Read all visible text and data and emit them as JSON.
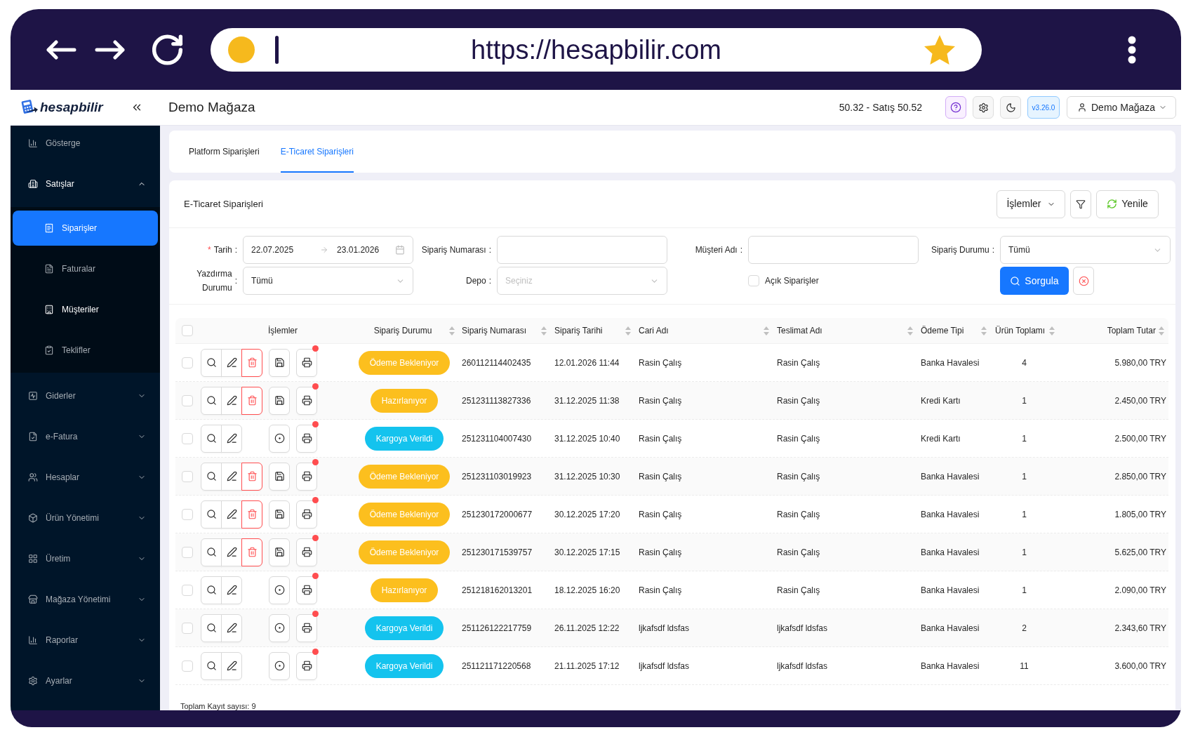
{
  "browser": {
    "url": "https://hesapbilir.com"
  },
  "header": {
    "logo": "hesapbilir",
    "title": "Demo Mağaza",
    "rate": "50.32 - Satış 50.52",
    "version": "v3.26.0",
    "user": "Demo Mağaza"
  },
  "sidebar": {
    "items": [
      {
        "label": "Gösterge",
        "selected": false
      },
      {
        "label": "Satışlar",
        "selected": false,
        "expanded": true,
        "children": [
          {
            "label": "Siparişler",
            "selected": true,
            "hovered": false
          },
          {
            "label": "Faturalar",
            "selected": false,
            "hovered": false
          },
          {
            "label": "Müşteriler",
            "selected": false,
            "hovered": true
          },
          {
            "label": "Teklifler",
            "selected": false,
            "hovered": false
          }
        ]
      },
      {
        "label": "Giderler",
        "selected": false,
        "expanded": false
      },
      {
        "label": "e-Fatura",
        "selected": false,
        "expanded": false
      },
      {
        "label": "Hesaplar",
        "selected": false,
        "expanded": false
      },
      {
        "label": "Ürün Yönetimi",
        "selected": false,
        "expanded": false
      },
      {
        "label": "Üretim",
        "selected": false,
        "expanded": false
      },
      {
        "label": "Mağaza Yönetimi",
        "selected": false,
        "expanded": false
      },
      {
        "label": "Raporlar",
        "selected": false,
        "expanded": false
      },
      {
        "label": "Ayarlar",
        "selected": false,
        "expanded": false
      }
    ]
  },
  "tabs": [
    {
      "label": "Platform Siparişleri",
      "selected": false
    },
    {
      "label": "E-Ticaret Siparişleri",
      "selected": true
    }
  ],
  "panel": {
    "title": "E-Ticaret Siparişleri",
    "menu_button": "İşlemler",
    "refresh_button": "Yenile",
    "query_button": "Sorgula",
    "filters": [
      {
        "kind": "date_range",
        "required_mark": "*",
        "label": "Tarih",
        "colon": ":",
        "start": "22.07.2025",
        "end": "23.01.2026"
      },
      {
        "kind": "text",
        "label": "Sipariş Numarası",
        "colon": ":"
      },
      {
        "kind": "text",
        "label": "Müşteri Adı",
        "colon": ":"
      },
      {
        "kind": "select",
        "label": "Sipariş Durumu",
        "colon": ":",
        "value": "Tümü"
      },
      {
        "kind": "select",
        "label": "Yazdırma Durumu",
        "colon": ":",
        "value": "Tümü"
      },
      {
        "kind": "select",
        "label": "Depo",
        "colon": ":",
        "placeholder": "Seçiniz"
      },
      {
        "kind": "checkbox",
        "label": "Açık Siparişler",
        "checked": false
      }
    ]
  },
  "table": {
    "select_all": false,
    "columns": [
      {
        "label": "İşlemler",
        "sortable": false
      },
      {
        "label": "Sipariş Durumu",
        "sortable": true
      },
      {
        "label": "Sipariş Numarası",
        "sortable": true
      },
      {
        "label": "Sipariş Tarihi",
        "sortable": true
      },
      {
        "label": "Cari Adı",
        "sortable": true
      },
      {
        "label": "Teslimat Adı",
        "sortable": true
      },
      {
        "label": "Ödeme Tipi",
        "sortable": true
      },
      {
        "label": "Ürün Toplamı",
        "sortable": true
      },
      {
        "label": "Toplam Tutar",
        "sortable": true
      }
    ],
    "rows": [
      {
        "selected": false,
        "deletable": true,
        "print_pending": true,
        "status": {
          "label": "Ödeme Bekleniyor",
          "color": "#fcbf1e"
        },
        "number": "260112114402435",
        "date": "12.01.2026 11:44",
        "customer": "Rasin Çalış",
        "recipient": "Rasin Çalış",
        "payment": "Banka Havalesi",
        "quantity": "4",
        "total": "5.980,00 TRY"
      },
      {
        "selected": false,
        "deletable": true,
        "print_pending": true,
        "status": {
          "label": "Hazırlanıyor",
          "color": "#fcbf1e"
        },
        "number": "251231113827336",
        "date": "31.12.2025 11:38",
        "customer": "Rasin Çalış",
        "recipient": "Rasin Çalış",
        "payment": "Kredi Kartı",
        "quantity": "1",
        "total": "2.450,00 TRY"
      },
      {
        "selected": false,
        "deletable": false,
        "print_pending": true,
        "status": {
          "label": "Kargoya Verildi",
          "color": "#14c3ee"
        },
        "number": "251231104007430",
        "date": "31.12.2025 10:40",
        "customer": "Rasin Çalış",
        "recipient": "Rasin Çalış",
        "payment": "Kredi Kartı",
        "quantity": "1",
        "total": "2.500,00 TRY"
      },
      {
        "selected": false,
        "deletable": true,
        "print_pending": true,
        "status": {
          "label": "Ödeme Bekleniyor",
          "color": "#fcbf1e"
        },
        "number": "251231103019923",
        "date": "31.12.2025 10:30",
        "customer": "Rasin Çalış",
        "recipient": "Rasin Çalış",
        "payment": "Banka Havalesi",
        "quantity": "1",
        "total": "2.850,00 TRY"
      },
      {
        "selected": false,
        "deletable": true,
        "print_pending": true,
        "status": {
          "label": "Ödeme Bekleniyor",
          "color": "#fcbf1e"
        },
        "number": "251230172000677",
        "date": "30.12.2025 17:20",
        "customer": "Rasin Çalış",
        "recipient": "Rasin Çalış",
        "payment": "Banka Havalesi",
        "quantity": "1",
        "total": "1.805,00 TRY"
      },
      {
        "selected": false,
        "deletable": true,
        "print_pending": true,
        "status": {
          "label": "Ödeme Bekleniyor",
          "color": "#fcbf1e"
        },
        "number": "251230171539757",
        "date": "30.12.2025 17:15",
        "customer": "Rasin Çalış",
        "recipient": "Rasin Çalış",
        "payment": "Banka Havalesi",
        "quantity": "1",
        "total": "5.625,00 TRY"
      },
      {
        "selected": false,
        "deletable": false,
        "print_pending": true,
        "status": {
          "label": "Hazırlanıyor",
          "color": "#fcbf1e"
        },
        "number": "251218162013201",
        "date": "18.12.2025 16:20",
        "customer": "Rasin Çalış",
        "recipient": "Rasin Çalış",
        "payment": "Banka Havalesi",
        "quantity": "1",
        "total": "2.090,00 TRY"
      },
      {
        "selected": false,
        "deletable": false,
        "print_pending": true,
        "status": {
          "label": "Kargoya Verildi",
          "color": "#14c3ee"
        },
        "number": "251126122217759",
        "date": "26.11.2025 12:22",
        "customer": "ljkafsdf ldsfas",
        "recipient": "ljkafsdf ldsfas",
        "payment": "Banka Havalesi",
        "quantity": "2",
        "total": "2.343,60 TRY"
      },
      {
        "selected": false,
        "deletable": false,
        "print_pending": true,
        "status": {
          "label": "Kargoya Verildi",
          "color": "#14c3ee"
        },
        "number": "251121171220568",
        "date": "21.11.2025 17:12",
        "customer": "ljkafsdf ldsfas",
        "recipient": "ljkafsdf ldsfas",
        "payment": "Banka Havalesi",
        "quantity": "11",
        "total": "3.600,00 TRY"
      }
    ],
    "footer": "Toplam Kayıt sayısı: 9"
  }
}
